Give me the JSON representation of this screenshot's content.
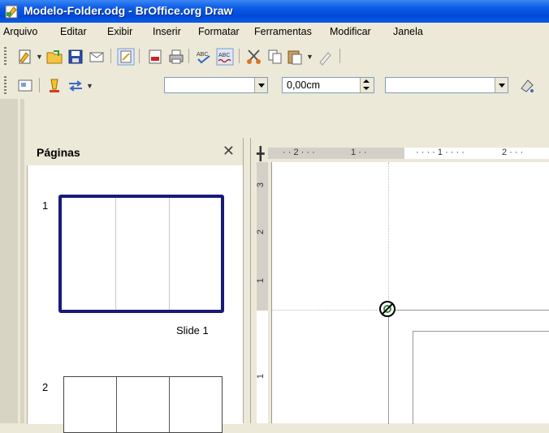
{
  "window": {
    "title": "Modelo-Folder.odg - BrOffice.org Draw"
  },
  "menu": [
    "Arquivo",
    "Editar",
    "Exibir",
    "Inserir",
    "Formatar",
    "Ferramentas",
    "Modificar",
    "Janela"
  ],
  "toolbar": {
    "line_width_value": "0,00cm"
  },
  "icons": {
    "app": "draw-app-icon",
    "new": "new-document-icon",
    "open": "open-folder-icon",
    "save": "save-icon",
    "email": "email-document-icon",
    "edit": "edit-file-icon",
    "export_pdf": "export-pdf-icon",
    "print": "print-icon",
    "spellcheck": "spellcheck-icon",
    "autospell": "auto-spellcheck-icon",
    "cut": "cut-icon",
    "copy": "copy-icon",
    "paste": "paste-icon",
    "clone": "clone-formatting-icon"
  },
  "pages_panel": {
    "title": "Páginas",
    "pages": [
      {
        "number": "1",
        "label": "Slide 1"
      },
      {
        "number": "2",
        "label": ""
      }
    ]
  },
  "ruler": {
    "horizontal": [
      "2",
      "1",
      "1",
      "2"
    ],
    "vertical": [
      "3",
      "2",
      "1",
      "1"
    ]
  },
  "colors": {
    "title_bar": "#0a5ce6",
    "selected_thumb": "#1a1a7a",
    "chrome": "#ece9d8"
  }
}
